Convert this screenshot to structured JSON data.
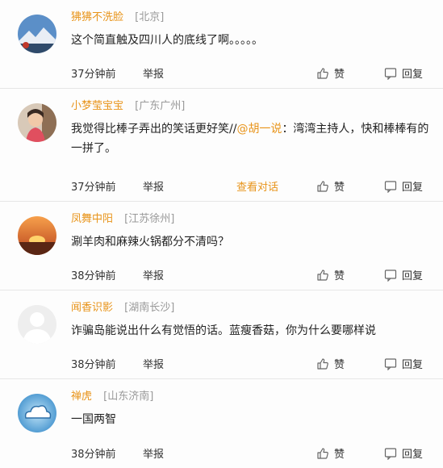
{
  "actions": {
    "report": "举报",
    "like": "赞",
    "reply": "回复",
    "view_conversation": "查看对话"
  },
  "comments": [
    {
      "nick": "狒狒不洗脸",
      "location": "[北京]",
      "text": "这个简直触及四川人的底线了啊。。。。。",
      "time": "37分钟前"
    },
    {
      "nick": "小梦莹宝宝",
      "location": "[广东广州]",
      "text_before": "我觉得比棒子弄出的笑话更好笑//",
      "mention": "@胡一说",
      "text_after": "：湾湾主持人，快和棒棒有的一拼了。",
      "time": "37分钟前"
    },
    {
      "nick": "凤舞中阳",
      "location": "[江苏徐州]",
      "text": "涮羊肉和麻辣火锅都分不清吗？",
      "time": "38分钟前"
    },
    {
      "nick": "闻香识影",
      "location": "[湖南长沙]",
      "text": "诈骗岛能说出什么有觉悟的话。蓝瘦香菇，你为什么要哪样说",
      "time": "38分钟前"
    },
    {
      "nick": "禅虎",
      "location": "[山东济南]",
      "text": "一国两智",
      "time": "38分钟前"
    }
  ]
}
